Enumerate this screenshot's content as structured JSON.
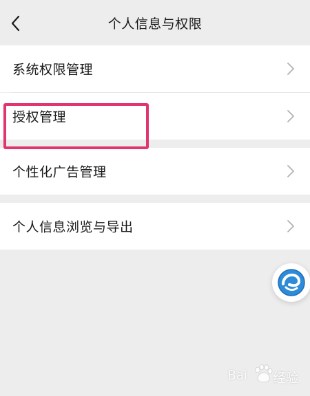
{
  "header": {
    "title": "个人信息与权限"
  },
  "menu": {
    "items": [
      {
        "label": "系统权限管理"
      },
      {
        "label": "授权管理"
      },
      {
        "label": "个性化广告管理"
      },
      {
        "label": "个人信息浏览与导出"
      }
    ]
  },
  "watermark": {
    "brand_left": "Bai",
    "brand_right": "经验"
  },
  "icons": {
    "back": "back-arrow-icon",
    "chevron": "chevron-right-icon",
    "floating": "browser-logo-icon",
    "paw": "paw-icon"
  },
  "colors": {
    "background": "#ededed",
    "row": "#ffffff",
    "highlight": "#e0356e",
    "chevron": "#b2b2b2",
    "floating_icon": "#2d8bd8"
  }
}
